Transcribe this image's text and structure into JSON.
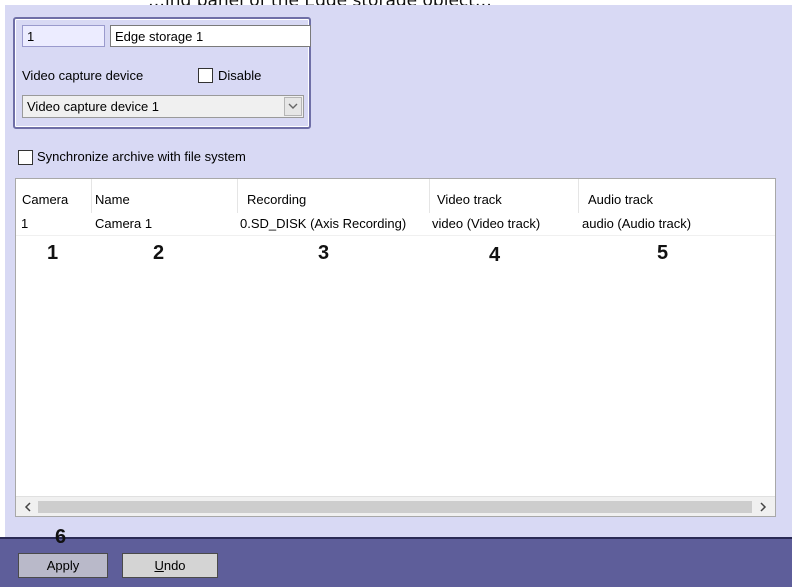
{
  "top_caption": "…ing panel of the Edge storage object…",
  "object": {
    "id_value": "1",
    "name_value": "Edge storage 1"
  },
  "video_capture": {
    "label": "Video capture device",
    "disable_label": "Disable",
    "disable_checked": false,
    "selected": "Video capture device 1"
  },
  "sync": {
    "label": "Synchronize archive with file system",
    "checked": false
  },
  "table": {
    "columns": [
      "Camera",
      "Name",
      "Recording",
      "Video track",
      "Audio track"
    ],
    "rows": [
      [
        "1",
        "Camera 1",
        "0.SD_DISK (Axis Recording)",
        "video (Video track)",
        "audio (Audio track)"
      ]
    ],
    "markers": [
      "1",
      "2",
      "3",
      "4",
      "5"
    ]
  },
  "buttons": {
    "apply": "Apply",
    "undo_first": "U",
    "undo_rest": "ndo",
    "apply_marker": "6"
  },
  "colors": {
    "panel_bg": "#d8d9f4",
    "bottom_bar": "#5e5e9a",
    "group_border": "#6f6fa7"
  }
}
